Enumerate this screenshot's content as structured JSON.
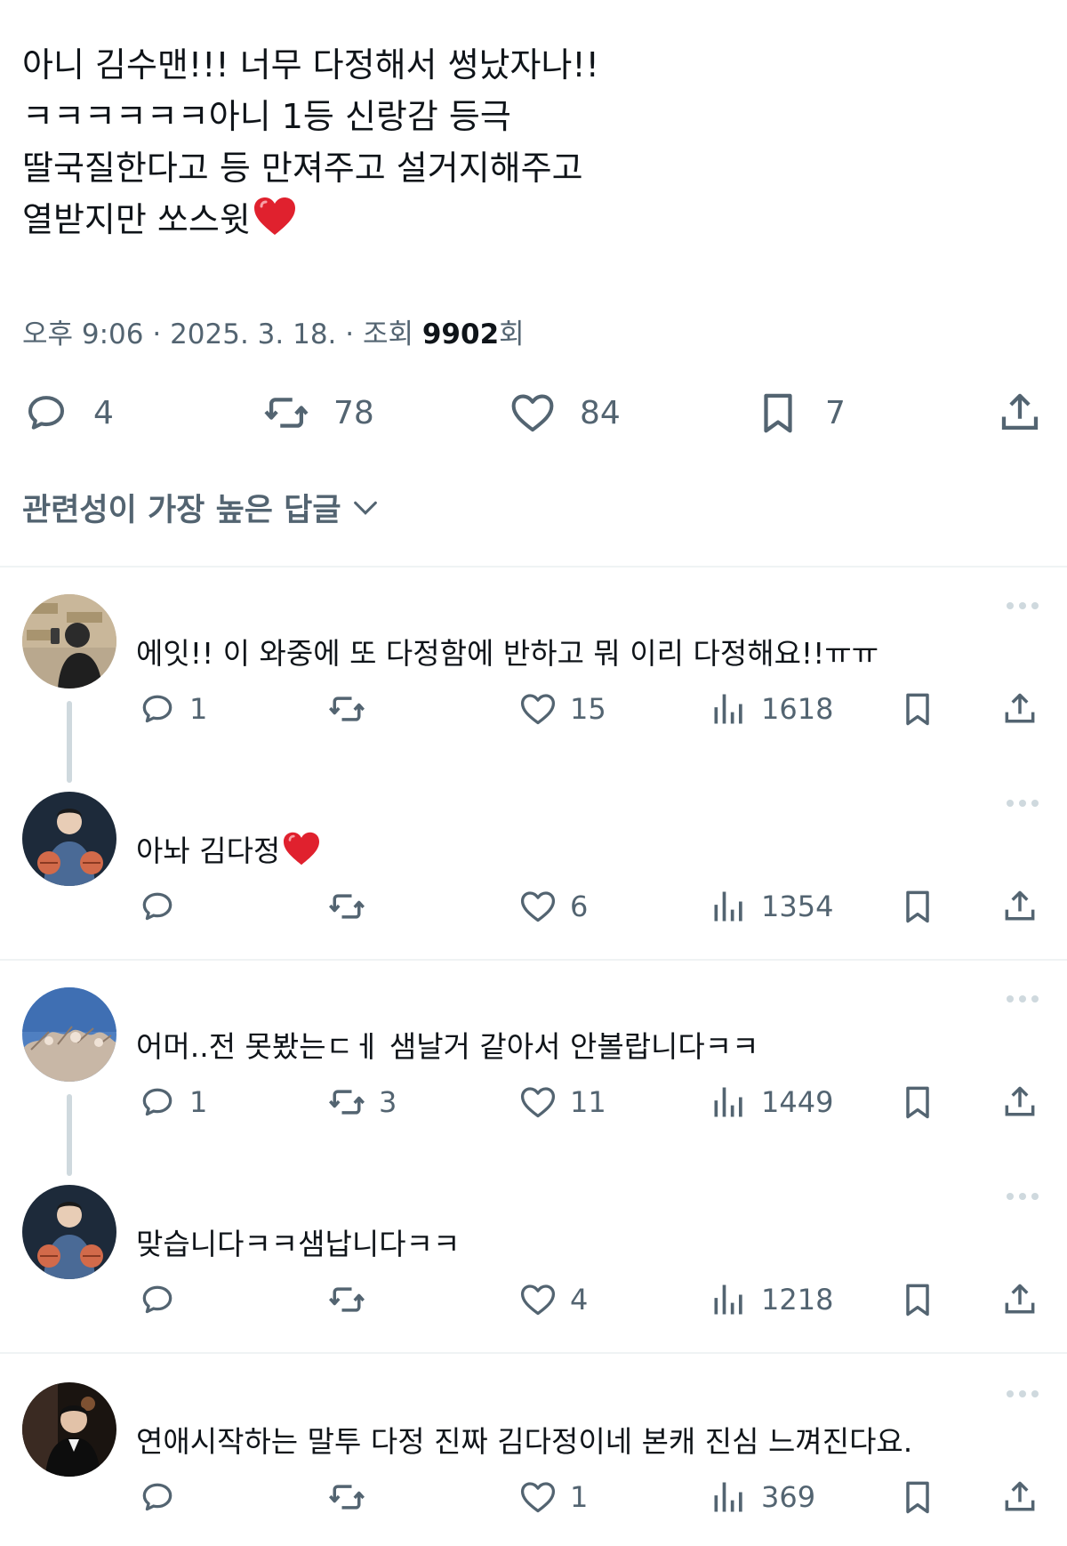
{
  "post": {
    "lines": [
      "아니 김수맨!!!  너무 다정해서 썽났자나!!",
      "ㅋㅋㅋㅋㅋㅋ아니 1등 신랑감 등극",
      "딸국질한다고 등 만져주고 설거지해주고",
      "열받지만  쏘스윗"
    ],
    "meta_time": "오후 9:06 · 2025. 3. 18. · 조회 ",
    "meta_views": "9902",
    "meta_suffix": "회",
    "counts": {
      "reply": "4",
      "retweet": "78",
      "like": "84",
      "bookmark": "7"
    }
  },
  "sort_label": "관련성이 가장 높은 답글",
  "replies": [
    {
      "text": "에잇!! 이 와중에 또 다정함에 반하고 뭐 이리 다정해요!!ㅠㅠ",
      "reply": "1",
      "retweet": "",
      "like": "15",
      "views": "1618"
    },
    {
      "text": "아놔 김다정",
      "reply": "",
      "retweet": "",
      "like": "6",
      "views": "1354"
    },
    {
      "text": "어머..전 못봤는ㄷㅔ 샘날거 같아서 안볼랍니다ㅋㅋ",
      "reply": "1",
      "retweet": "3",
      "like": "11",
      "views": "1449"
    },
    {
      "text": "맞습니다ㅋㅋ샘납니다ㅋㅋ",
      "reply": "",
      "retweet": "",
      "like": "4",
      "views": "1218"
    },
    {
      "text": "연애시작하는  말투 다정 진짜 김다정이네 본캐 진심 느껴진다요.",
      "reply": "",
      "retweet": "",
      "like": "1",
      "views": "369"
    }
  ],
  "colors": {
    "text": "#0f1419",
    "secondary": "#536471",
    "divider": "#eff3f4",
    "heart_emoji": "#e0212e"
  }
}
